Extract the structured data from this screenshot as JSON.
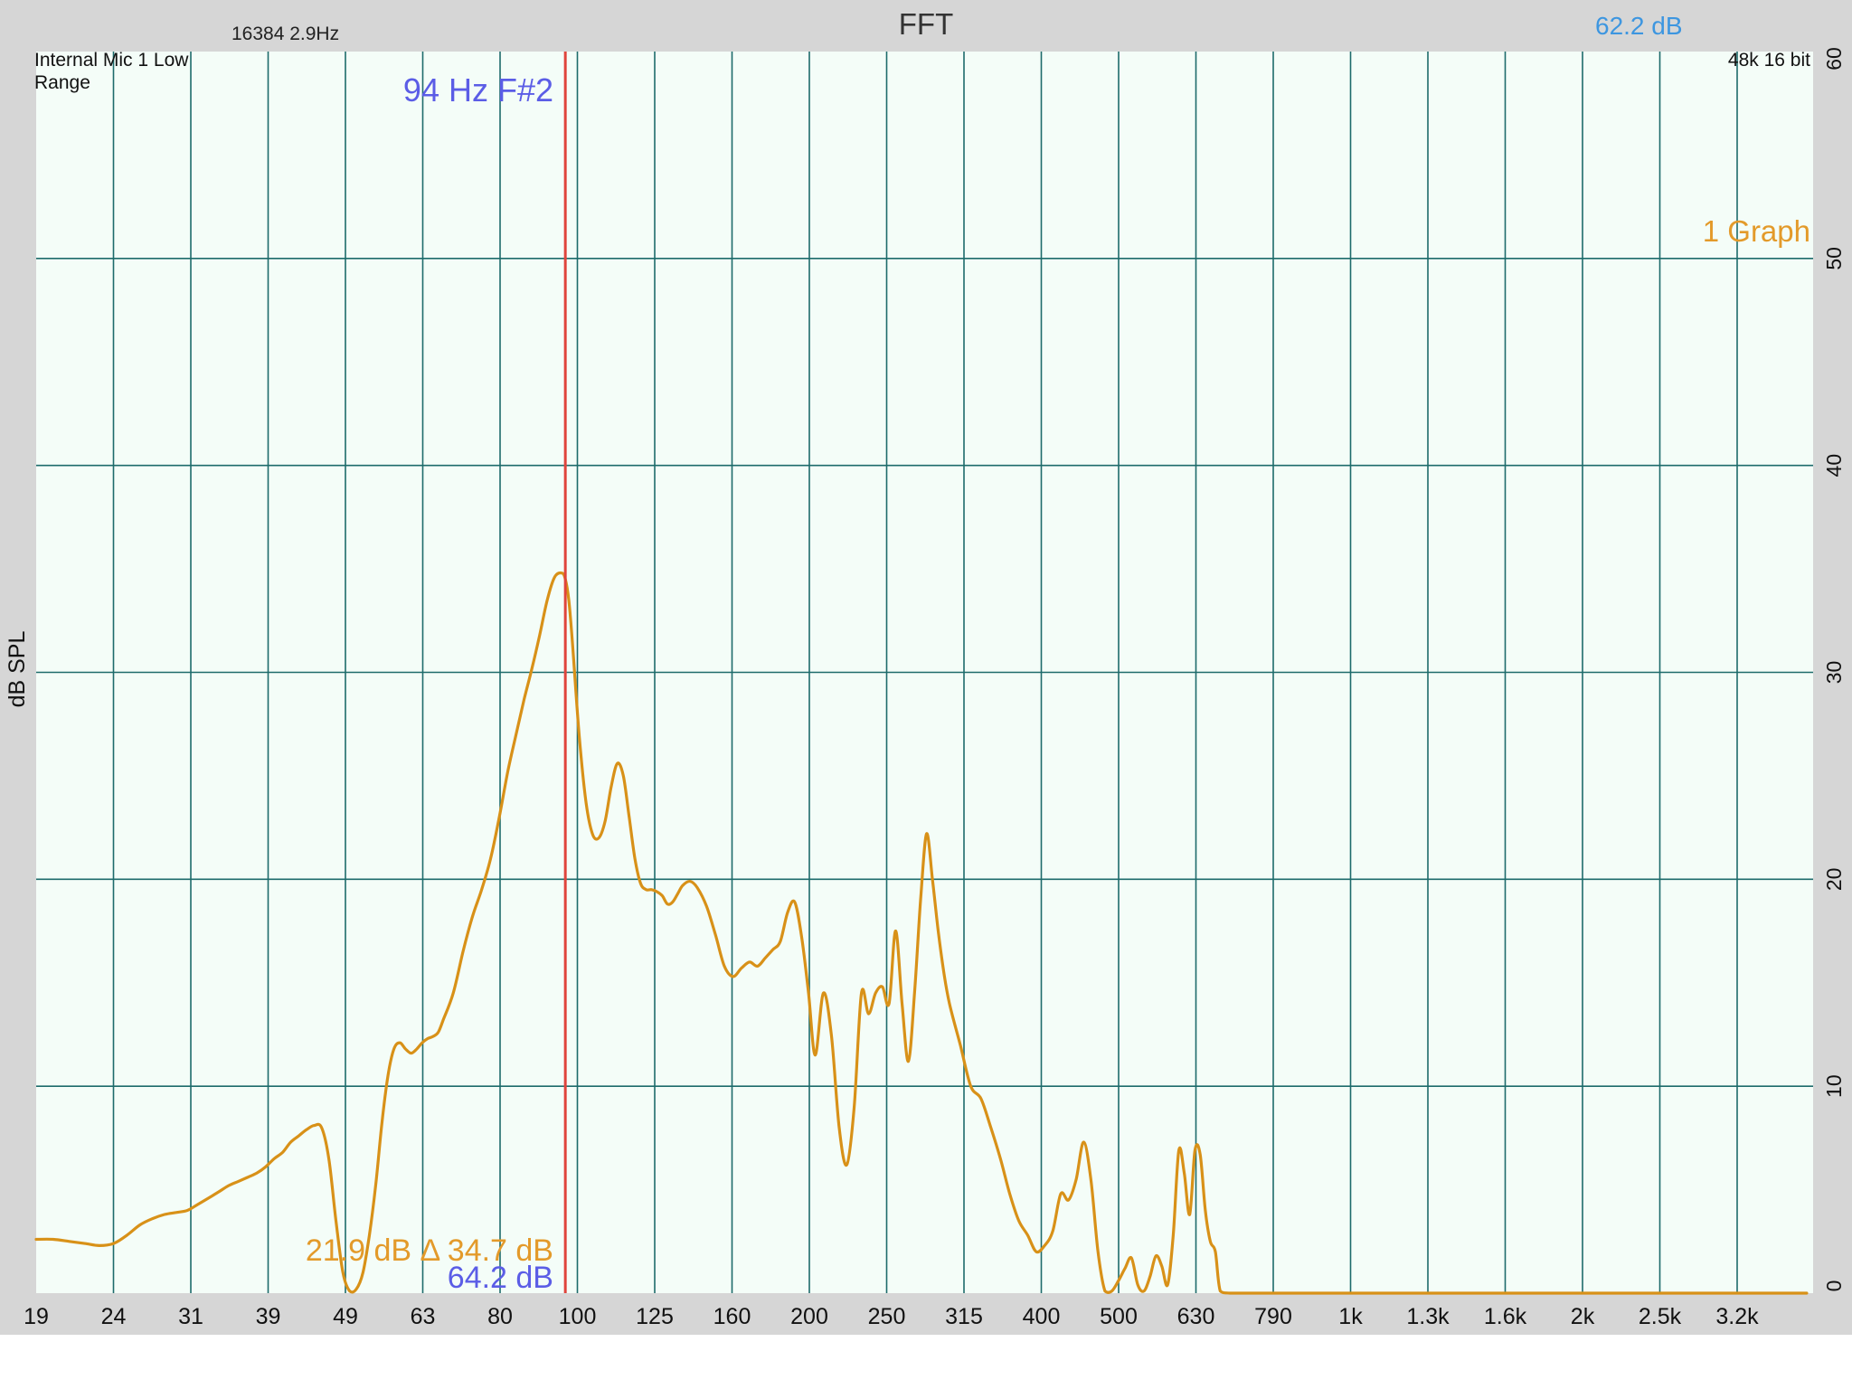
{
  "header": {
    "title": "FFT",
    "fft_info": "16384  2.9Hz",
    "level_readout": "62.2 dB",
    "input_source": [
      "Internal Mic 1 Low",
      "Range"
    ],
    "format": "48k 16 bit"
  },
  "cursor": {
    "label": "94 Hz F#2",
    "frequency_hz": 94,
    "level_line": "21.9 dB Δ 34.7 dB",
    "peak_readout": "64.2 dB"
  },
  "graph_count_label": "1 Graph",
  "colors": {
    "plot_background": "#f4fdf8",
    "frame": "#d6d6d6",
    "grid": "#1d6b6b",
    "trace": "#d89118",
    "cursor": "#e0443c",
    "cursor_text": "#5b5de6",
    "level_text": "#3d96e0",
    "trace_text": "#e39a2a"
  },
  "chart_data": {
    "type": "line",
    "title": "FFT",
    "xlabel": "",
    "ylabel": "dB SPL",
    "x_scale": "log",
    "xlim": [
      19,
      4300
    ],
    "ylim": [
      0,
      60
    ],
    "grid": true,
    "x_ticks": [
      "19",
      "24",
      "31",
      "39",
      "49",
      "63",
      "80",
      "100",
      "125",
      "160",
      "200",
      "250",
      "315",
      "400",
      "500",
      "630",
      "790",
      "1k",
      "1.3k",
      "1.6k",
      "2k",
      "2.5k",
      "3.2k"
    ],
    "x_tick_values": [
      19,
      24,
      31,
      39,
      49,
      63,
      80,
      100,
      125,
      160,
      200,
      250,
      315,
      400,
      500,
      630,
      790,
      1000,
      1300,
      1600,
      2000,
      2500,
      3200
    ],
    "y_ticks": [
      "0",
      "10",
      "20",
      "30",
      "40",
      "50",
      "60"
    ],
    "y_tick_values": [
      0,
      10,
      20,
      30,
      40,
      50,
      60
    ],
    "series": [
      {
        "name": "",
        "x": [
          19,
          20,
          21,
          22,
          23,
          24,
          25,
          26,
          27,
          28,
          29,
          30,
          31,
          32,
          33,
          34,
          35,
          36,
          37,
          38,
          39,
          40,
          41,
          42,
          43,
          44,
          45,
          46,
          47,
          48,
          49,
          50,
          51,
          52,
          53,
          54,
          55,
          56,
          57,
          58,
          59,
          60,
          61,
          62,
          63,
          64,
          65,
          67,
          69,
          71,
          73,
          75,
          77,
          79,
          81,
          83,
          85,
          87,
          89,
          91,
          93,
          94,
          95,
          96,
          98,
          100,
          102,
          104,
          106,
          108,
          110,
          112,
          114,
          116,
          118,
          120,
          122,
          124,
          126,
          128,
          130,
          132,
          134,
          137,
          140,
          144,
          148,
          152,
          156,
          160,
          164,
          168,
          172,
          176,
          180,
          184,
          188,
          192,
          196,
          200,
          205,
          210,
          215,
          220,
          225,
          230,
          235,
          240,
          245,
          250,
          255,
          260,
          265,
          270,
          275,
          280,
          285,
          290,
          295,
          300,
          310,
          320,
          330,
          340,
          350,
          360,
          370,
          380,
          390,
          400,
          410,
          420,
          430,
          440,
          450,
          460,
          470,
          480,
          490,
          500,
          510,
          520,
          530,
          540,
          550,
          560,
          570,
          580,
          590,
          600,
          610,
          620,
          630,
          640,
          650,
          660,
          670,
          680,
          700,
          750,
          790,
          850,
          1000,
          1300,
          1600,
          2000,
          2500,
          3200,
          4000
        ],
        "y": [
          2.6,
          2.6,
          2.5,
          2.4,
          2.3,
          2.4,
          2.8,
          3.3,
          3.6,
          3.8,
          3.9,
          4.0,
          4.3,
          4.6,
          4.9,
          5.2,
          5.4,
          5.6,
          5.8,
          6.1,
          6.5,
          6.8,
          7.3,
          7.6,
          7.9,
          8.1,
          8.0,
          6.5,
          3.5,
          1.0,
          0.1,
          0.2,
          1.0,
          2.8,
          5.2,
          8.2,
          10.5,
          11.8,
          12.1,
          11.8,
          11.6,
          11.8,
          12.1,
          12.3,
          12.4,
          12.6,
          13.2,
          14.5,
          16.5,
          18.2,
          19.5,
          21.0,
          23.0,
          25.2,
          27.0,
          28.7,
          30.2,
          31.8,
          33.5,
          34.6,
          34.8,
          34.5,
          33.5,
          31.5,
          27.0,
          23.8,
          22.2,
          22.0,
          22.8,
          24.5,
          25.6,
          25.0,
          23.0,
          21.0,
          19.8,
          19.5,
          19.5,
          19.4,
          19.2,
          18.8,
          18.9,
          19.3,
          19.7,
          19.9,
          19.6,
          18.7,
          17.3,
          15.8,
          15.3,
          15.7,
          16.0,
          15.8,
          16.2,
          16.6,
          17.0,
          18.4,
          18.9,
          17.2,
          14.5,
          11.5,
          14.5,
          12.5,
          8.0,
          6.2,
          9.0,
          14.5,
          13.5,
          14.5,
          14.8,
          14.0,
          17.5,
          14.0,
          11.2,
          14.5,
          19.0,
          22.2,
          20.0,
          17.5,
          15.5,
          14.0,
          12.0,
          10.0,
          9.4,
          8.0,
          6.5,
          4.8,
          3.5,
          2.8,
          2.0,
          2.3,
          3.0,
          4.8,
          4.5,
          5.5,
          7.3,
          5.5,
          2.0,
          0.1,
          0.1,
          0.6,
          1.2,
          1.7,
          0.4,
          0.1,
          0.8,
          1.8,
          1.3,
          0.4,
          2.8,
          6.9,
          5.8,
          3.8,
          6.9,
          6.7,
          4.0,
          2.5,
          2.0,
          0.1,
          0.0,
          0.0,
          0.0,
          0.0,
          0.0,
          0.0,
          0.0,
          0.0,
          0.0,
          0.0,
          0.0
        ]
      }
    ]
  }
}
